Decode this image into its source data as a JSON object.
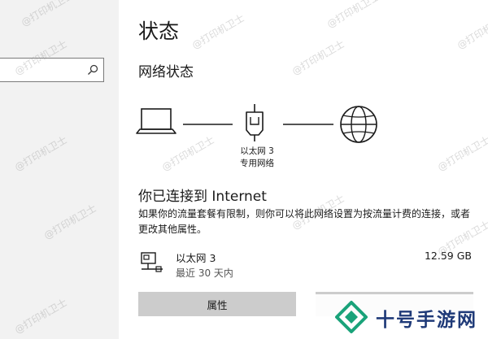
{
  "search": {
    "placeholder": ""
  },
  "page": {
    "title": "状态",
    "network_status_heading": "网络状态"
  },
  "diagram": {
    "adapter_label_line1": "以太网 3",
    "adapter_label_line2": "专用网络",
    "icons": [
      "laptop-icon",
      "ethernet-adapter-icon",
      "globe-icon"
    ]
  },
  "connection": {
    "title": "你已连接到 Internet",
    "description": "如果你的流量套餐有限制，则你可以将此网络设置为按流量计费的连接，或者更改其他属性。"
  },
  "adapter": {
    "name": "以太网 3",
    "period": "最近 30 天内",
    "usage": "12.59 GB"
  },
  "buttons": {
    "properties": "属性",
    "second": ""
  },
  "watermark": "@打印机卫士",
  "brand": {
    "text": "十号手游网"
  },
  "colors": {
    "sidebar_bg": "#f2f2f2",
    "button_bg": "#cccccc",
    "brand_text": "#1f3a78",
    "brand_green": "#1aa37a"
  }
}
